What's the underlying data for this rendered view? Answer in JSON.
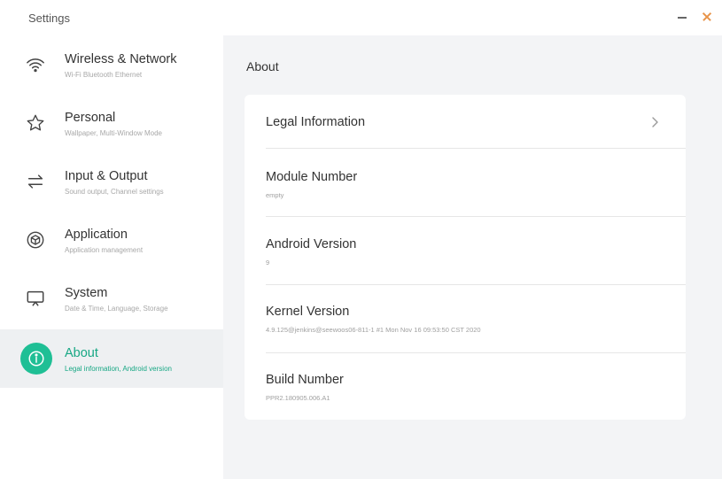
{
  "window": {
    "title": "Settings"
  },
  "sidebar": {
    "items": [
      {
        "label": "Wireless & Network",
        "subtitle": "Wi-Fi Bluetooth Ethernet",
        "icon": "wifi-icon",
        "active": false
      },
      {
        "label": "Personal",
        "subtitle": "Wallpaper, Multi-Window Mode",
        "icon": "star-icon",
        "active": false
      },
      {
        "label": "Input & Output",
        "subtitle": "Sound output, Channel settings",
        "icon": "swap-arrows-icon",
        "active": false
      },
      {
        "label": "Application",
        "subtitle": "Application management",
        "icon": "cube-icon",
        "active": false
      },
      {
        "label": "System",
        "subtitle": "Date & Time, Language, Storage",
        "icon": "monitor-icon",
        "active": false
      },
      {
        "label": "About",
        "subtitle": "Legal information, Android version",
        "icon": "info-icon",
        "active": true
      }
    ]
  },
  "main": {
    "title": "About",
    "rows": [
      {
        "title": "Legal Information",
        "value": "",
        "has_chevron": true
      },
      {
        "title": "Module Number",
        "value": "empty"
      },
      {
        "title": "Android Version",
        "value": "9"
      },
      {
        "title": "Kernel Version",
        "value": "4.9.125@jenkins@seewoos06-811-1 #1 Mon Nov 16 09:53:50 CST 2020"
      },
      {
        "title": "Build Number",
        "value": "PPR2.180905.006.A1"
      }
    ]
  },
  "colors": {
    "accent": "#1fbf95",
    "active_bg": "#eef0f2",
    "content_bg": "#f3f4f6",
    "close": "#e8944a"
  }
}
